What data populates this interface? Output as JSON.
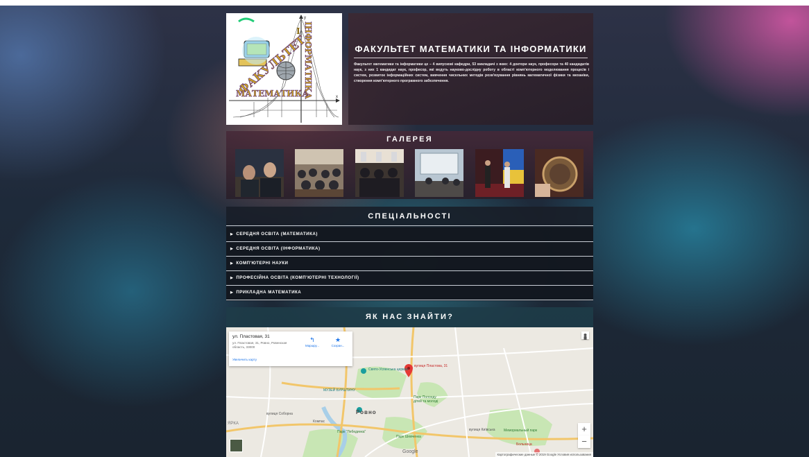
{
  "header": {
    "logo_vertical_text": "ІНФОРМАТИКА",
    "logo_arc_text": "ФАКУЛЬТЕТ",
    "logo_bottom_text": "МАТЕМАТИКА",
    "axis_y": "y",
    "axis_x": "x",
    "title": "ФАКУЛЬТЕТ МАТЕМАТИКИ ТА ІНФОРМАТИКИ",
    "description": "Факультет математики та інформатики це – 4 випускові кафедри, 53 викладачі з яких: 4 доктори наук, професори та 40 кандидатів наук, з них 1 кандидат наук, професор, які ведуть науково-дослідну роботу в області комп'ютерного моделювання процесів і систем, розвиток інформаційних систем, вивчення чисельних методів розв'язування рівнянь математичної фізики та механіки, створення комп'ютерного програмного забезпечення."
  },
  "gallery": {
    "title": "ГАЛЕРЕЯ",
    "photo_count": 6
  },
  "specialities": {
    "title": "СПЕЦІАЛЬНОСТІ",
    "items": [
      {
        "label": "СЕРЕДНЯ ОСВІТА (МАТЕМАТИКА)"
      },
      {
        "label": "СЕРЕДНЯ ОСВІТА (ІНФОРМАТИКА)"
      },
      {
        "label": "КОМП'ЮТЕРНІ НАУКИ"
      },
      {
        "label": "ПРОФЕСІЙНА ОСВІТА (КОМП'ЮТЕРНІ ТЕХНОЛОГІЇ)"
      },
      {
        "label": "ПРИКЛАДНА МАТЕМАТИКА"
      }
    ],
    "item_icon": "triangle-right-icon"
  },
  "location": {
    "title": "ЯК НАС ЗНАЙТИ?",
    "map": {
      "place_name": "ул. Пластовая, 31",
      "full_address": "ул. Пластовая, 31, Ровно, Ровенская область, 33000",
      "directions_label": "Маршру...",
      "save_label": "Сохран...",
      "enlarge_label": "Увеличить карту",
      "marker_label": "вулиця Пластова, 31",
      "city_label": "Ровно",
      "labels": {
        "church": "Свято-Успенська церква",
        "museum": "МУЗЕЙ БУРШТИНУ",
        "park": "Парк Полонду дітей та молоді",
        "compass": "Компас",
        "park_lebed": "Парк \"Лебединка\"",
        "park_shevchenko": "Парк Шевченка",
        "memorial": "Мемориальный парк",
        "hospital": "Больница",
        "sobornaya": "вулиця Соборна",
        "kyivska": "вулиця Київська",
        "rka": "ЯРКА"
      },
      "zoom_in": "+",
      "zoom_out": "−",
      "attribution": "Картографические данные © 2019 Google   Условия использования",
      "google": "Google"
    }
  },
  "colors": {
    "marker": "#e53935",
    "link": "#1a73e8"
  }
}
